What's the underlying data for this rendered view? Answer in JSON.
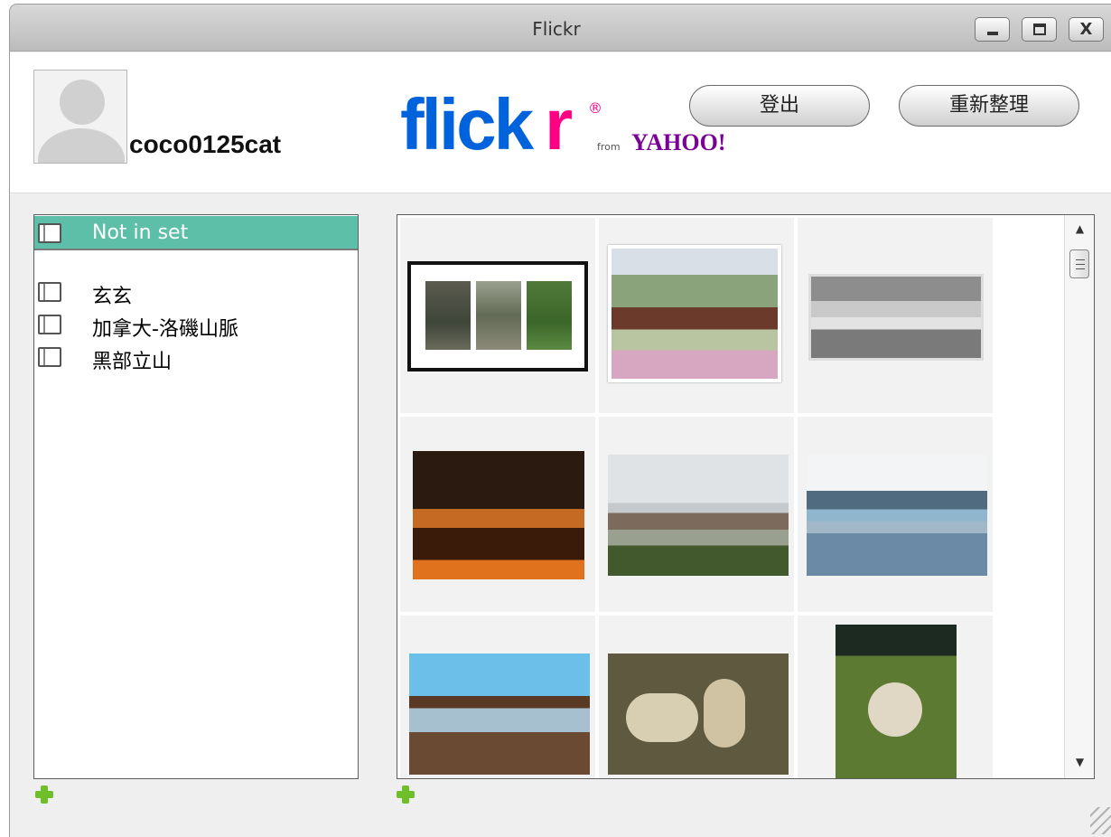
{
  "window": {
    "title": "Flickr"
  },
  "user": {
    "name": "coco0125cat"
  },
  "logo": {
    "flick": "flick",
    "r": "r",
    "reg": "®",
    "from": "from",
    "yahoo": "YAHOO!"
  },
  "buttons": {
    "logout": "登出",
    "refresh": "重新整理",
    "close": "X"
  },
  "sets": [
    {
      "label": "Not in set",
      "selected": true
    },
    {
      "label": "玄玄",
      "selected": false
    },
    {
      "label": "加拿大-洛磯山脈",
      "selected": false
    },
    {
      "label": "黑部立山",
      "selected": false
    }
  ],
  "scrollbar": {
    "up": "▲",
    "down": "▼"
  },
  "icons": {
    "minimize": "minimize-icon",
    "maximize": "maximize-icon",
    "close": "close-icon",
    "album": "album-icon",
    "add": "plus-icon",
    "avatar": "user-avatar-icon"
  },
  "colors": {
    "selected_row": "#5ebfa8",
    "flickr_blue": "#0063dc",
    "flickr_pink": "#ff0084",
    "yahoo_purple": "#7b0099",
    "add_green": "#6fbf2a"
  }
}
